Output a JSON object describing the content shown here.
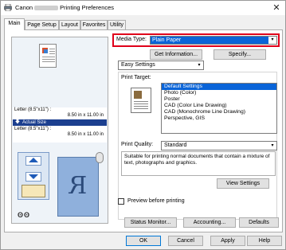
{
  "window": {
    "title_prefix": "Canon",
    "title_suffix": "Printing Preferences",
    "close_glyph": "✕"
  },
  "tabs": [
    {
      "label": "Main",
      "active": true
    },
    {
      "label": "Page Setup",
      "active": false
    },
    {
      "label": "Layout",
      "active": false
    },
    {
      "label": "Favorites",
      "active": false
    },
    {
      "label": "Utility",
      "active": false
    }
  ],
  "preview": {
    "size_top_name": "Letter (8.5\"x11\") :",
    "size_top_dims": "8.50 in x 11.00 in",
    "actual_size": "Actual Size",
    "size_bottom_name": "Letter (8.5\"x11\") :",
    "size_bottom_dims": "8.50 in x 11.00 in",
    "roll_glyph": "ʘʘ"
  },
  "media": {
    "label": "Media Type:",
    "value": "Plain Paper"
  },
  "buttons": {
    "get_information": "Get Information...",
    "specify": "Specify...",
    "view_settings": "View Settings",
    "status_monitor": "Status Monitor...",
    "accounting": "Accounting...",
    "defaults": "Defaults",
    "ok": "OK",
    "cancel": "Cancel",
    "apply": "Apply",
    "help": "Help"
  },
  "easy_settings": {
    "value": "Easy Settings"
  },
  "print_target": {
    "label": "Print Target:",
    "items": [
      "Default Settings",
      "Photo (Color)",
      "Poster",
      "CAD (Color Line Drawing)",
      "CAD (Monochrome Line Drawing)",
      "Perspective, GIS"
    ],
    "selected_index": 0
  },
  "print_quality": {
    "label": "Print Quality:",
    "value": "Standard"
  },
  "description": "Suitable for printing normal documents that contain a mixture of text, photographs and graphics.",
  "preview_before_printing": {
    "label": "Preview before printing",
    "checked": false
  },
  "colors": {
    "highlight": "#e0001a",
    "selection": "#0a64d8",
    "actual_bar": "#1c3f8f"
  }
}
